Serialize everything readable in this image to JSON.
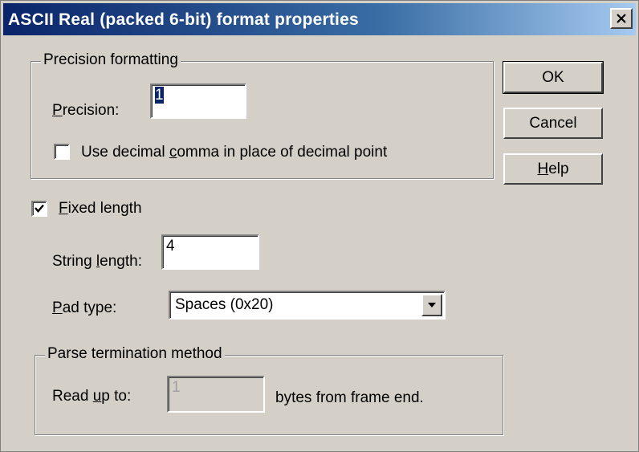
{
  "window": {
    "title": "ASCII Real (packed 6-bit) format properties",
    "close_label": "×"
  },
  "precision_group": {
    "legend": "Precision formatting",
    "precision_label_pre": "",
    "precision_label_u": "P",
    "precision_label_post": "recision:",
    "precision_value": "1",
    "decimal_comma_label_pre": "Use decimal ",
    "decimal_comma_label_u": "c",
    "decimal_comma_label_post": "omma in place of decimal point",
    "decimal_comma_checked": false
  },
  "fixed_length": {
    "label_u": "F",
    "label_post": "ixed length",
    "checked": true,
    "string_length_label_pre": "String ",
    "string_length_label_u": "l",
    "string_length_label_post": "ength:",
    "string_length_value": "4",
    "pad_type_label_u": "P",
    "pad_type_label_post": "ad type:",
    "pad_type_value": "Spaces (0x20)"
  },
  "parse_group": {
    "legend": "Parse termination method",
    "read_label_pre": "Read ",
    "read_label_u": "u",
    "read_label_post": "p to:",
    "read_value": "1",
    "suffix": "bytes from frame end."
  },
  "buttons": {
    "ok": "OK",
    "cancel": "Cancel",
    "help_u": "H",
    "help_post": "elp"
  },
  "icons": {
    "close": "close-icon",
    "check": "check-icon",
    "dropdown": "chevron-down-icon"
  }
}
